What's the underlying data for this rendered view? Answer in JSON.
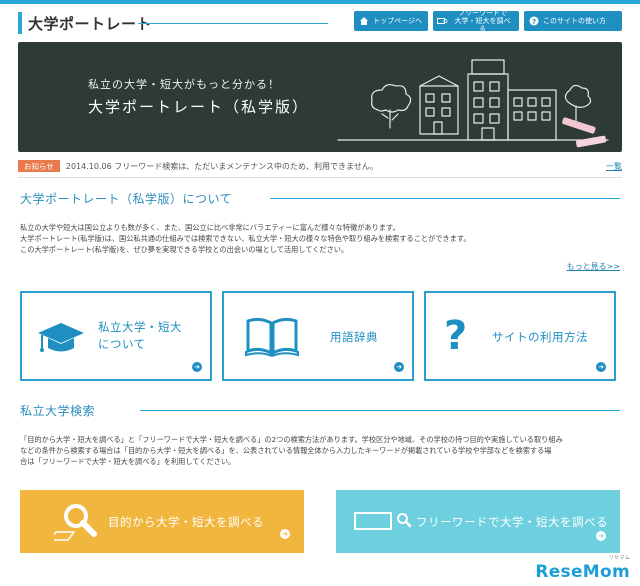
{
  "header": {
    "logo_text": "大学ポートレート",
    "buttons": [
      {
        "label": "トップページへ",
        "icon": "home-icon"
      },
      {
        "label_line1": "フリーワードで",
        "label_line2": "大学・短大を調べる",
        "icon": "search-box-icon"
      },
      {
        "label": "このサイトの使い方",
        "icon": "question-icon"
      }
    ]
  },
  "banner": {
    "subtitle": "私立の大学・短大がもっと分かる！",
    "title": "大学ポートレート（私学版）"
  },
  "news": {
    "badge": "お知らせ",
    "text": "2014.10.06 フリーワード検索は、ただいまメンテナンス中のため、利用できません。",
    "more": "一覧"
  },
  "about": {
    "title": "大学ポートレート（私学版）について",
    "lines": [
      "私立の大学や短大は国公立よりも数が多く、また、国公立に比べ非常にバラエティーに富んだ様々な特徴があります。",
      "大学ポートレート(私学版)は、国公私共通の仕組みでは検索できない、私立大学・短大の様々な特色や取り組みを検索することができます。",
      "この大学ポートレート(私学版)を、ぜひ夢を実現できる学校との出会いの場として活用してください。"
    ],
    "more": "もっと見る>>"
  },
  "cards": [
    {
      "line1": "私立大学・短大",
      "line2": "について",
      "icon": "graduation-cap-icon"
    },
    {
      "line1": "用語辞典",
      "icon": "book-icon"
    },
    {
      "line1": "サイトの利用方法",
      "icon": "question-mark-icon"
    }
  ],
  "search": {
    "title": "私立大学検索",
    "lines": [
      "「目的から大学・短大を調べる」と「フリーワードで大学・短大を調べる」の2つの検索方法があります。学校区分や地域、その学校の持つ目的や実施している取り組み",
      "などの条件から検索する場合は「目的から大学・短大を調べる」を、公表されている情報全体から入力したキーワードが掲載されている学校や学部などを検索する場",
      "合は「フリーワードで大学・短大を調べる」を利用してください。"
    ],
    "button_purpose": "目的から大学・短大を調べる",
    "button_freeword": "フリーワードで大学・短大を調べる"
  },
  "watermark": {
    "text": "ReseMom",
    "kana": "リセマム"
  },
  "colors": {
    "accent": "#2aa9d8",
    "button_blue": "#1f8fc2",
    "notice_orange": "#e87a4e",
    "search_yellow": "#f0b63d",
    "search_cyan": "#6ed0df",
    "chalkboard": "#2e3a36"
  }
}
